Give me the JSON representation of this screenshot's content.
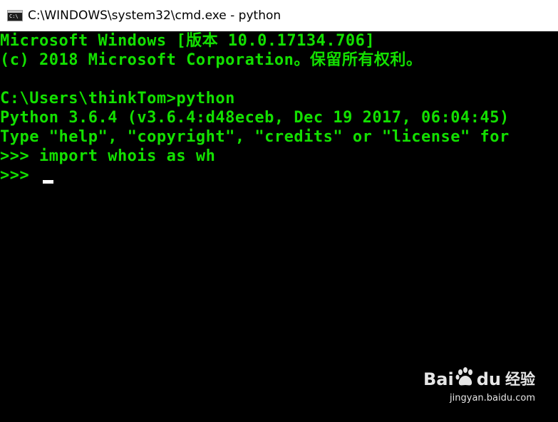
{
  "window": {
    "title": "C:\\WINDOWS\\system32\\cmd.exe - python",
    "icon_label": "C:\\",
    "icon": "cmd-console-icon"
  },
  "console": {
    "lines": [
      "Microsoft Windows [版本 10.0.17134.706]",
      "(c) 2018 Microsoft Corporation。保留所有权利。",
      "",
      "C:\\Users\\thinkTom>python",
      "Python 3.6.4 (v3.6.4:d48eceb, Dec 19 2017, 06:04:45)",
      "Type \"help\", \"copyright\", \"credits\" or \"license\" for",
      ">>> import whois as wh",
      ">>> "
    ],
    "text_color": "#13e000",
    "background_color": "#000000"
  },
  "watermark": {
    "bai": "Bai",
    "du": "du",
    "jingyan": "经验",
    "url": "jingyan.baidu.com",
    "icon": "baidu-paw-icon"
  }
}
